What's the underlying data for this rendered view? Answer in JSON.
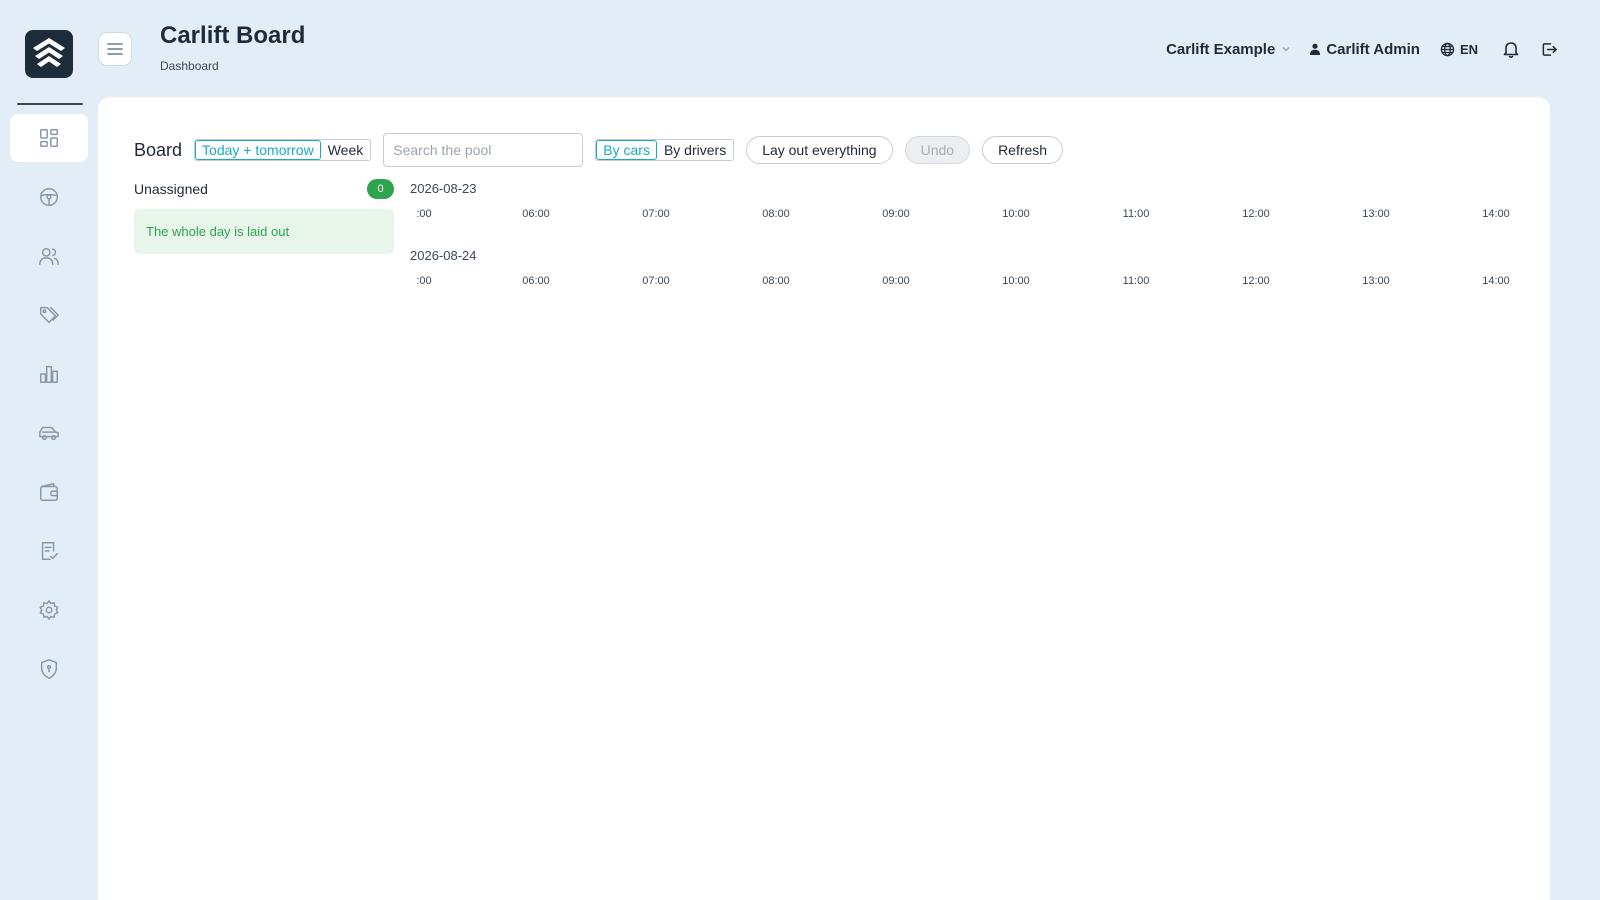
{
  "header": {
    "title": "Carlift Board",
    "breadcrumb": "Dashboard",
    "company": "Carlift Example",
    "user": "Carlift Admin",
    "language": "EN"
  },
  "sidebar": {
    "items": [
      {
        "icon": "dashboard-icon",
        "active": true
      },
      {
        "icon": "steering-wheel-icon",
        "active": false
      },
      {
        "icon": "users-icon",
        "active": false
      },
      {
        "icon": "tags-icon",
        "active": false
      },
      {
        "icon": "bar-chart-icon",
        "active": false
      },
      {
        "icon": "car-icon",
        "active": false
      },
      {
        "icon": "wallet-icon",
        "active": false
      },
      {
        "icon": "checklist-icon",
        "active": false
      },
      {
        "icon": "gear-icon",
        "active": false
      },
      {
        "icon": "shield-icon",
        "active": false
      }
    ]
  },
  "toolbar": {
    "board_label": "Board",
    "range_today": "Today + tomorrow",
    "range_week": "Week",
    "search_placeholder": "Search the pool",
    "by_cars": "By cars",
    "by_drivers": "By drivers",
    "layout_all": "Lay out everything",
    "undo": "Undo",
    "refresh": "Refresh"
  },
  "unassigned": {
    "label": "Unassigned",
    "count": "0",
    "message": "The whole day is laid out"
  },
  "timeline": {
    "days": [
      {
        "date": "2026-08-23",
        "hours": [
          ":00",
          "06:00",
          "07:00",
          "08:00",
          "09:00",
          "10:00",
          "11:00",
          "12:00",
          "13:00",
          "14:00"
        ]
      },
      {
        "date": "2026-08-24",
        "hours": [
          ":00",
          "06:00",
          "07:00",
          "08:00",
          "09:00",
          "10:00",
          "11:00",
          "12:00",
          "13:00",
          "14:00"
        ]
      }
    ]
  },
  "colors": {
    "accent": "#1ba9c4",
    "success": "#2ea44f",
    "sidebar_bg": "#e3edf7"
  }
}
